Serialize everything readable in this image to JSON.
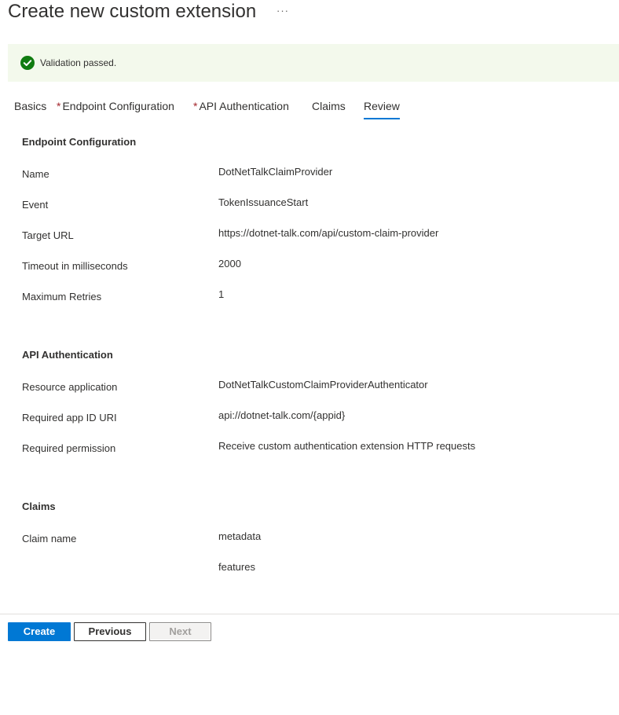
{
  "header": {
    "title": "Create new custom extension",
    "more_label": "···"
  },
  "banner": {
    "icon": "check-circle-icon",
    "text": "Validation passed.",
    "color": "#107c10"
  },
  "tabs": [
    {
      "label": "Basics",
      "required": false,
      "active": false
    },
    {
      "label": "Endpoint Configuration",
      "required": true,
      "active": false
    },
    {
      "label": "API Authentication",
      "required": true,
      "active": false
    },
    {
      "label": "Claims",
      "required": false,
      "active": false
    },
    {
      "label": "Review",
      "required": false,
      "active": true
    }
  ],
  "required_marker": "*",
  "endpoint": {
    "title": "Endpoint Configuration",
    "fields": [
      {
        "label": "Name",
        "value": "DotNetTalkClaimProvider"
      },
      {
        "label": "Event",
        "value": "TokenIssuanceStart"
      },
      {
        "label": "Target URL",
        "value": "https://dotnet-talk.com/api/custom-claim-provider"
      },
      {
        "label": "Timeout in milliseconds",
        "value": "2000"
      },
      {
        "label": "Maximum Retries",
        "value": "1"
      }
    ]
  },
  "api_auth": {
    "title": "API Authentication",
    "fields": [
      {
        "label": "Resource application",
        "value": "DotNetTalkCustomClaimProviderAuthenticator"
      },
      {
        "label": "Required app ID URI",
        "value": "api://dotnet-talk.com/{appid}"
      },
      {
        "label": "Required permission",
        "value": "Receive custom authentication extension HTTP requests"
      }
    ]
  },
  "claims": {
    "title": "Claims",
    "label": "Claim name",
    "values": [
      "metadata",
      "features"
    ]
  },
  "footer": {
    "create_label": "Create",
    "previous_label": "Previous",
    "next_label": "Next"
  },
  "colors": {
    "accent": "#0078d4",
    "required": "#a4262c",
    "success_bg": "#f3f9ec"
  }
}
